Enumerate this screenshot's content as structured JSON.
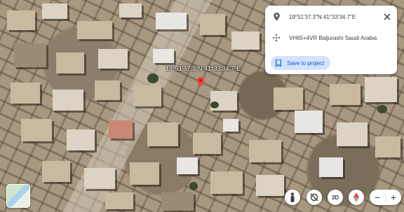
{
  "map": {
    "view": "satellite",
    "pin_label": "19°51'37.3\"N 41°33'34.7\"E",
    "pin_icon": "red-location-pin-icon"
  },
  "info_card": {
    "coordinates": "19°51'37.3\"N 41°33'34.7\"E",
    "plus_code": "VH65+4VR Baljurashi Saudi Arabia",
    "save_label": "Save to project",
    "icons": [
      "location-pin-icon",
      "plus-code-icon",
      "bookmark-icon",
      "close-icon"
    ]
  },
  "controls": {
    "tilt_label": "3D",
    "zoom_in": "+",
    "zoom_out": "−",
    "accent_color": "#0b57d0",
    "save_bg": "#d3e3fd",
    "pin_color": "#ea4335"
  }
}
